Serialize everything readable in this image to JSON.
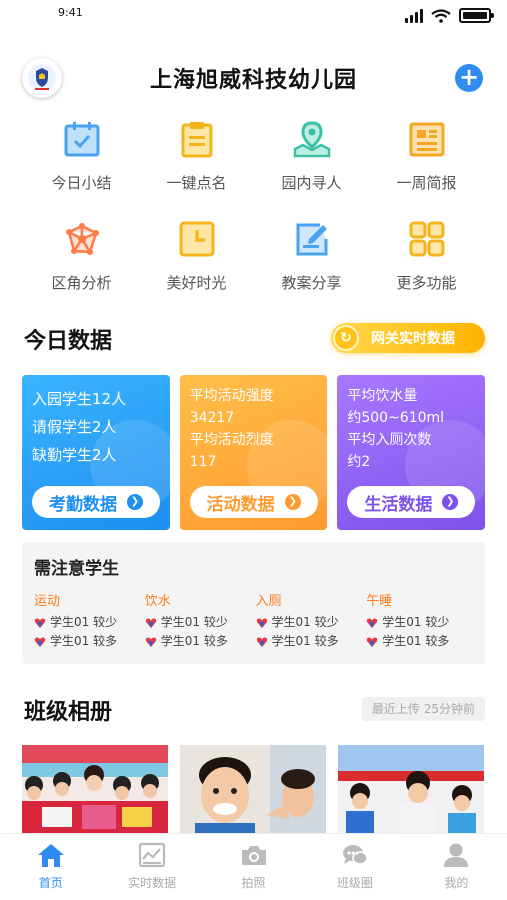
{
  "status_bar": {
    "time": "9:41"
  },
  "header": {
    "title": "上海旭威科技幼儿园"
  },
  "quick_actions": [
    {
      "label": "今日小结",
      "icon": "calendar-check-icon",
      "color": "#4aa3f0"
    },
    {
      "label": "一键点名",
      "icon": "clipboard-icon",
      "color": "#f5b51a"
    },
    {
      "label": "园内寻人",
      "icon": "map-pin-icon",
      "color": "#3bc2a6"
    },
    {
      "label": "一周简报",
      "icon": "newspaper-icon",
      "color": "#f5a623"
    },
    {
      "label": "区角分析",
      "icon": "network-icon",
      "color": "#ff7a45"
    },
    {
      "label": "美好时光",
      "icon": "clock-icon",
      "color": "#f5b51a"
    },
    {
      "label": "教案分享",
      "icon": "edit-doc-icon",
      "color": "#4aa3f0"
    },
    {
      "label": "更多功能",
      "icon": "grid-icon",
      "color": "#f5b51a"
    }
  ],
  "today": {
    "title": "今日数据",
    "live_button": "网关实时数据",
    "cards": [
      {
        "lines": [
          "入园学生12人",
          "请假学生2人",
          "缺勤学生2人"
        ],
        "button": "考勤数据"
      },
      {
        "lines": [
          "平均活动强度",
          "34217",
          "平均活动烈度",
          "117"
        ],
        "button": "活动数据"
      },
      {
        "lines": [
          "平均饮水量",
          "约500~610ml",
          "平均入厕次数",
          "约2"
        ],
        "button": "生活数据"
      }
    ]
  },
  "attention": {
    "title": "需注意学生",
    "columns": [
      {
        "category": "运动",
        "rows": [
          "学生01 较少",
          "学生01 较多"
        ]
      },
      {
        "category": "饮水",
        "rows": [
          "学生01 较少",
          "学生01 较多"
        ]
      },
      {
        "category": "入厕",
        "rows": [
          "学生01 较少",
          "学生01 较多"
        ]
      },
      {
        "category": "午睡",
        "rows": [
          "学生01 较少",
          "学生01 较多"
        ]
      }
    ]
  },
  "album": {
    "title": "班级相册",
    "recent": "最近上传 25分钟前"
  },
  "tabbar": [
    {
      "label": "首页",
      "icon": "home-icon",
      "active": true
    },
    {
      "label": "实时数据",
      "icon": "chart-icon",
      "active": false
    },
    {
      "label": "拍照",
      "icon": "camera-icon",
      "active": false
    },
    {
      "label": "班级圈",
      "icon": "chat-icon",
      "active": false
    },
    {
      "label": "我的",
      "icon": "user-icon",
      "active": false
    }
  ]
}
